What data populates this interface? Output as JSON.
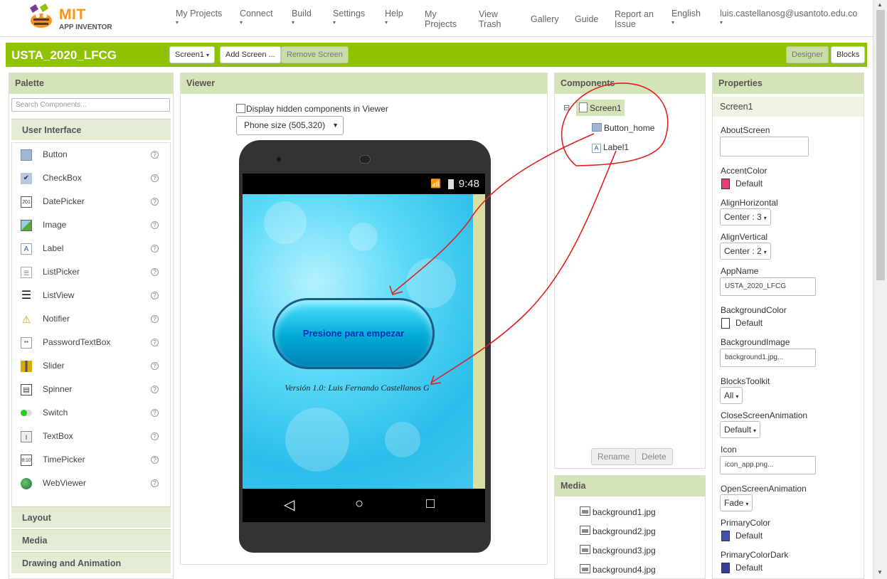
{
  "logo": {
    "mit": "MIT",
    "sub": "APP INVENTOR"
  },
  "nav": {
    "my_projects_dd": "My Projects",
    "connect": "Connect",
    "build": "Build",
    "settings": "Settings",
    "help": "Help",
    "my_projects_1": "My",
    "my_projects_2": "Projects",
    "view_trash_1": "View",
    "view_trash_2": "Trash",
    "gallery": "Gallery",
    "guide": "Guide",
    "report_1": "Report an",
    "report_2": "Issue",
    "language": "English",
    "user": "luis.castellanosg@usantoto.edu.co"
  },
  "toolbar": {
    "project_name": "USTA_2020_LFCG",
    "screen_select": "Screen1",
    "add_screen": "Add Screen ...",
    "remove_screen": "Remove Screen",
    "designer": "Designer",
    "blocks": "Blocks"
  },
  "palette": {
    "title": "Palette",
    "search_placeholder": "Search Components...",
    "category_open": "User Interface",
    "items": [
      {
        "label": "Button",
        "icon": "button-icon"
      },
      {
        "label": "CheckBox",
        "icon": "checkbox-icon"
      },
      {
        "label": "DatePicker",
        "icon": "datepicker-icon"
      },
      {
        "label": "Image",
        "icon": "image-icon"
      },
      {
        "label": "Label",
        "icon": "label-icon"
      },
      {
        "label": "ListPicker",
        "icon": "listpicker-icon"
      },
      {
        "label": "ListView",
        "icon": "listview-icon"
      },
      {
        "label": "Notifier",
        "icon": "notifier-icon"
      },
      {
        "label": "PasswordTextBox",
        "icon": "password-icon"
      },
      {
        "label": "Slider",
        "icon": "slider-icon"
      },
      {
        "label": "Spinner",
        "icon": "spinner-icon"
      },
      {
        "label": "Switch",
        "icon": "switch-icon"
      },
      {
        "label": "TextBox",
        "icon": "textbox-icon"
      },
      {
        "label": "TimePicker",
        "icon": "timepicker-icon"
      },
      {
        "label": "WebViewer",
        "icon": "webviewer-icon"
      }
    ],
    "help_glyph": "?",
    "categories_closed": [
      "Layout",
      "Media",
      "Drawing and Animation"
    ]
  },
  "viewer": {
    "title": "Viewer",
    "hidden_checkbox_label": "Display hidden components in Viewer",
    "phone_size": "Phone size (505,320)",
    "clock": "9:48",
    "button_text": "Presione para empezar",
    "label_text": "Versión 1.0: Luis Fernando Castellanos G"
  },
  "components": {
    "title": "Components",
    "collapse": "⊟",
    "tree": [
      "Screen1",
      "Button_home",
      "Label1"
    ],
    "rename": "Rename",
    "delete": "Delete"
  },
  "media": {
    "title": "Media",
    "files": [
      "background1.jpg",
      "background2.jpg",
      "background3.jpg",
      "background4.jpg"
    ]
  },
  "properties": {
    "title": "Properties",
    "screen": "Screen1",
    "about_screen": "AboutScreen",
    "accent_color": "AccentColor",
    "accent_value": "Default",
    "accent_hex": "#e8406a",
    "align_h": "AlignHorizontal",
    "align_h_value": "Center : 3",
    "align_v": "AlignVertical",
    "align_v_value": "Center : 2",
    "app_name": "AppName",
    "app_name_value": "USTA_2020_LFCG",
    "bg_color": "BackgroundColor",
    "bg_color_value": "Default",
    "bg_color_hex": "#ffffff",
    "bg_image": "BackgroundImage",
    "bg_image_value": "background1.jpg...",
    "blocks_toolkit": "BlocksToolkit",
    "blocks_toolkit_value": "All",
    "close_anim": "CloseScreenAnimation",
    "close_anim_value": "Default",
    "icon": "Icon",
    "icon_value": "icon_app.png...",
    "open_anim": "OpenScreenAnimation",
    "open_anim_value": "Fade",
    "primary_color": "PrimaryColor",
    "primary_color_value": "Default",
    "primary_hex": "#3f51b5",
    "primary_dark": "PrimaryColorDark",
    "primary_dark_value": "Default",
    "primary_dark_hex": "#303f9f"
  },
  "colors": {
    "brand_green": "#8fc202",
    "panel_head": "#d5e4b8",
    "annotation": "#e02020"
  }
}
